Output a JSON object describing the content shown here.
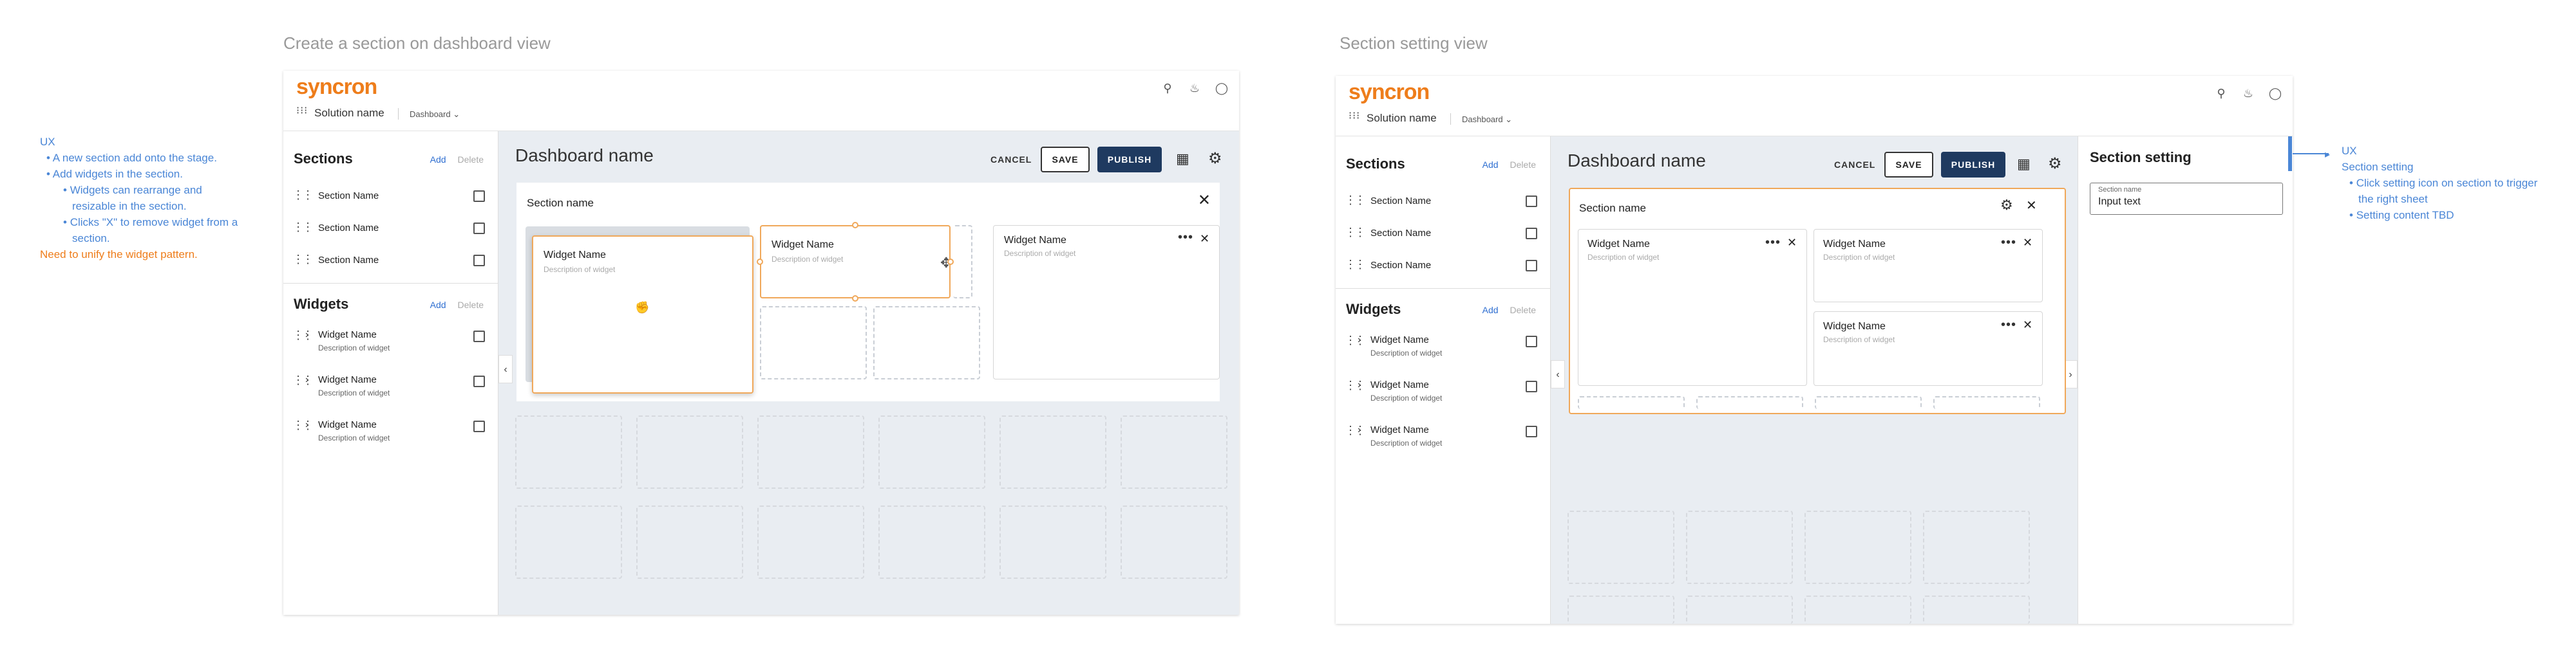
{
  "left_view": {
    "frame_title": "Create a section on dashboard view",
    "notes": {
      "heading": "UX",
      "items": [
        "A new section add onto the stage.",
        "Add widgets in the section.",
        "Widgets can rearrange and",
        "resizable in the section.",
        "Clicks \"X\" to remove widget from a",
        "section."
      ],
      "warning": "Need to unify the widget pattern."
    }
  },
  "right_view": {
    "frame_title": "Section setting view",
    "notes": {
      "heading": "UX",
      "subheading": "Section setting",
      "items": [
        "Click setting icon on section to trigger",
        "the right sheet",
        "Setting content TBD"
      ]
    },
    "setting_sheet": {
      "title": "Section setting",
      "field_label": "Section name",
      "field_value": "Input text"
    }
  },
  "app": {
    "logo": "syncron",
    "solution_name": "Solution name",
    "dashboard_dropdown": "Dashboard",
    "icons": [
      "search-icon",
      "bell-icon",
      "account-icon",
      "apps-icon"
    ],
    "sections_panel": {
      "title": "Sections",
      "add": "Add",
      "delete": "Delete",
      "items": [
        "Section Name",
        "Section Name",
        "Section Name"
      ]
    },
    "widgets_panel": {
      "title": "Widgets",
      "add": "Add",
      "delete": "Delete",
      "items": [
        {
          "name": "Widget Name",
          "desc": "Description of widget"
        },
        {
          "name": "Widget Name",
          "desc": "Description of widget"
        },
        {
          "name": "Widget Name",
          "desc": "Description of widget"
        }
      ]
    },
    "dashboard_name": "Dashboard name",
    "cancel": "CANCEL",
    "save": "SAVE",
    "publish": "PUBLISH",
    "section_name": "Section name",
    "widget_name": "Widget Name",
    "widget_desc": "Description of widget"
  },
  "colors": {
    "accent": "#ee7d1b",
    "primary": "#1f3a60",
    "link": "#4a86d6"
  }
}
